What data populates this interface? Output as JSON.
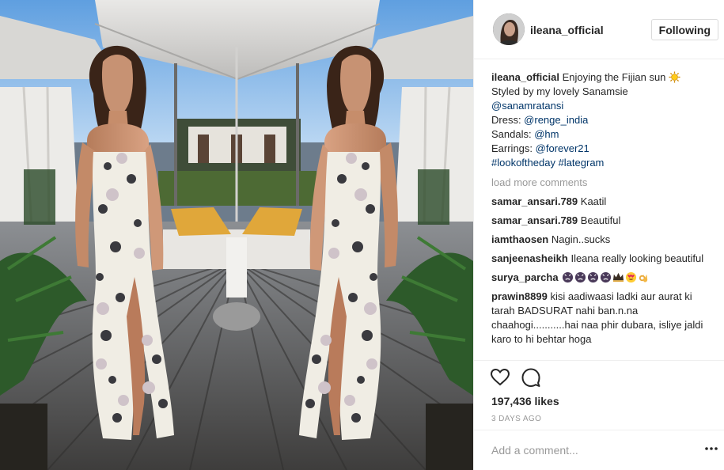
{
  "header": {
    "username": "ileana_official",
    "follow_label": "Following"
  },
  "caption": {
    "username": "ileana_official",
    "text": "Enjoying the Fijian sun",
    "line2": "Styled by my lovely Sanamsie",
    "mention_stylist": "@sanamratansi",
    "dress_label": "Dress: ",
    "dress_mention": "@renge_india",
    "sandals_label": "Sandals: ",
    "sandals_mention": "@hm",
    "earrings_label": "Earrings: ",
    "earrings_mention": "@forever21",
    "hashtag1": "#lookoftheday",
    "hashtag2": "#lategram"
  },
  "load_more": "load more comments",
  "comments": [
    {
      "user": "samar_ansari.789",
      "text": "Kaatil"
    },
    {
      "user": "samar_ansari.789",
      "text": "Beautiful"
    },
    {
      "user": "iamthaosen",
      "text": "Nagin..sucks"
    },
    {
      "user": "sanjeenasheikh",
      "text": "Ileana really looking beautiful"
    },
    {
      "user": "surya_parcha",
      "text": ""
    },
    {
      "user": "prawin8899",
      "text": "kisi aadiwaasi ladki aur aurat ki tarah BADSURAT nahi ban.n.na chaahogi...........hai naa phir dubara, isliye jaldi karo to hi behtar hoga"
    }
  ],
  "surya_emojis": [
    "angry-face-icon",
    "angry-face-icon",
    "angry-face-icon",
    "angry-face-icon",
    "crown-icon",
    "heart-eyes-icon",
    "ok-hand-icon"
  ],
  "likes": "197,436 likes",
  "timestamp": "3 DAYS AGO",
  "add_comment_placeholder": "Add a comment...",
  "colors": {
    "link": "#003569",
    "muted": "#999999",
    "text": "#262626",
    "border": "#efefef"
  }
}
